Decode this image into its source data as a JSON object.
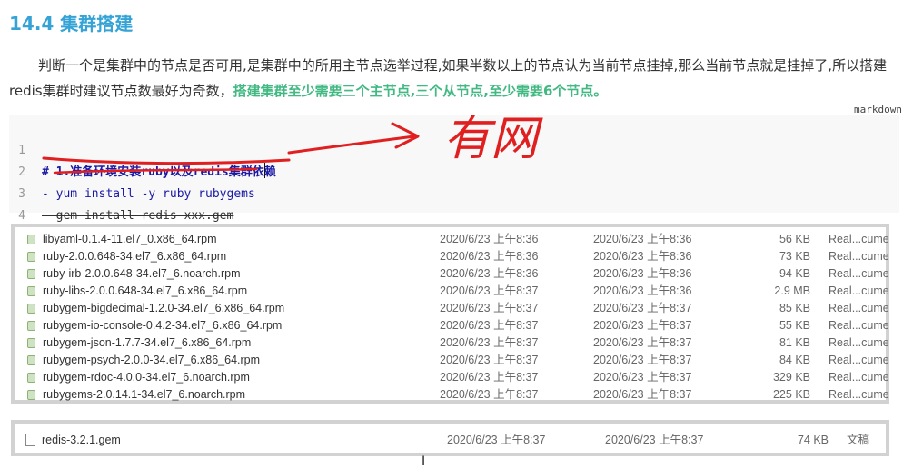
{
  "heading": "14.4 集群搭建",
  "paragraph": {
    "text": "判断一个是集群中的节点是否可用,是集群中的所用主节点选举过程,如果半数以上的节点认为当前节点挂掉,那么当前节点就是挂掉了,所以搭建redis集群时建议节点数最好为奇数，",
    "highlight": "搭建集群至少需要三个主节点,三个从节点,至少需要6个节点。"
  },
  "code": {
    "language": "markdown",
    "lines": [
      {
        "num": "1",
        "text": "# 1.准备环境安装ruby以及redis集群依赖"
      },
      {
        "num": "2",
        "text": "- yum install -y ruby rubygems"
      },
      {
        "num": "3",
        "text": "- gem install redis-xxx.gem"
      },
      {
        "num": "4",
        "text": ""
      }
    ]
  },
  "annotation": {
    "text": "有网",
    "color": "#e02020"
  },
  "files": [
    {
      "name": "libyaml-0.1.4-11.el7_0.x86_64.rpm",
      "modified": "2020/6/23 上午8:36",
      "created": "2020/6/23 上午8:36",
      "size": "56 KB",
      "kind": "Real...cume"
    },
    {
      "name": "ruby-2.0.0.648-34.el7_6.x86_64.rpm",
      "modified": "2020/6/23 上午8:36",
      "created": "2020/6/23 上午8:36",
      "size": "73 KB",
      "kind": "Real...cume"
    },
    {
      "name": "ruby-irb-2.0.0.648-34.el7_6.noarch.rpm",
      "modified": "2020/6/23 上午8:36",
      "created": "2020/6/23 上午8:36",
      "size": "94 KB",
      "kind": "Real...cume"
    },
    {
      "name": "ruby-libs-2.0.0.648-34.el7_6.x86_64.rpm",
      "modified": "2020/6/23 上午8:37",
      "created": "2020/6/23 上午8:36",
      "size": "2.9 MB",
      "kind": "Real...cume"
    },
    {
      "name": "rubygem-bigdecimal-1.2.0-34.el7_6.x86_64.rpm",
      "modified": "2020/6/23 上午8:37",
      "created": "2020/6/23 上午8:37",
      "size": "85 KB",
      "kind": "Real...cume"
    },
    {
      "name": "rubygem-io-console-0.4.2-34.el7_6.x86_64.rpm",
      "modified": "2020/6/23 上午8:37",
      "created": "2020/6/23 上午8:37",
      "size": "55 KB",
      "kind": "Real...cume"
    },
    {
      "name": "rubygem-json-1.7.7-34.el7_6.x86_64.rpm",
      "modified": "2020/6/23 上午8:37",
      "created": "2020/6/23 上午8:37",
      "size": "81 KB",
      "kind": "Real...cume"
    },
    {
      "name": "rubygem-psych-2.0.0-34.el7_6.x86_64.rpm",
      "modified": "2020/6/23 上午8:37",
      "created": "2020/6/23 上午8:37",
      "size": "84 KB",
      "kind": "Real...cume"
    },
    {
      "name": "rubygem-rdoc-4.0.0-34.el7_6.noarch.rpm",
      "modified": "2020/6/23 上午8:37",
      "created": "2020/6/23 上午8:37",
      "size": "329 KB",
      "kind": "Real...cume"
    },
    {
      "name": "rubygems-2.0.14.1-34.el7_6.noarch.rpm",
      "modified": "2020/6/23 上午8:37",
      "created": "2020/6/23 上午8:37",
      "size": "225 KB",
      "kind": "Real...cume"
    }
  ],
  "gem_file": {
    "name": "redis-3.2.1.gem",
    "modified": "2020/6/23 上午8:37",
    "created": "2020/6/23 上午8:37",
    "size": "74 KB",
    "kind": "文稿"
  },
  "cursor": "I"
}
